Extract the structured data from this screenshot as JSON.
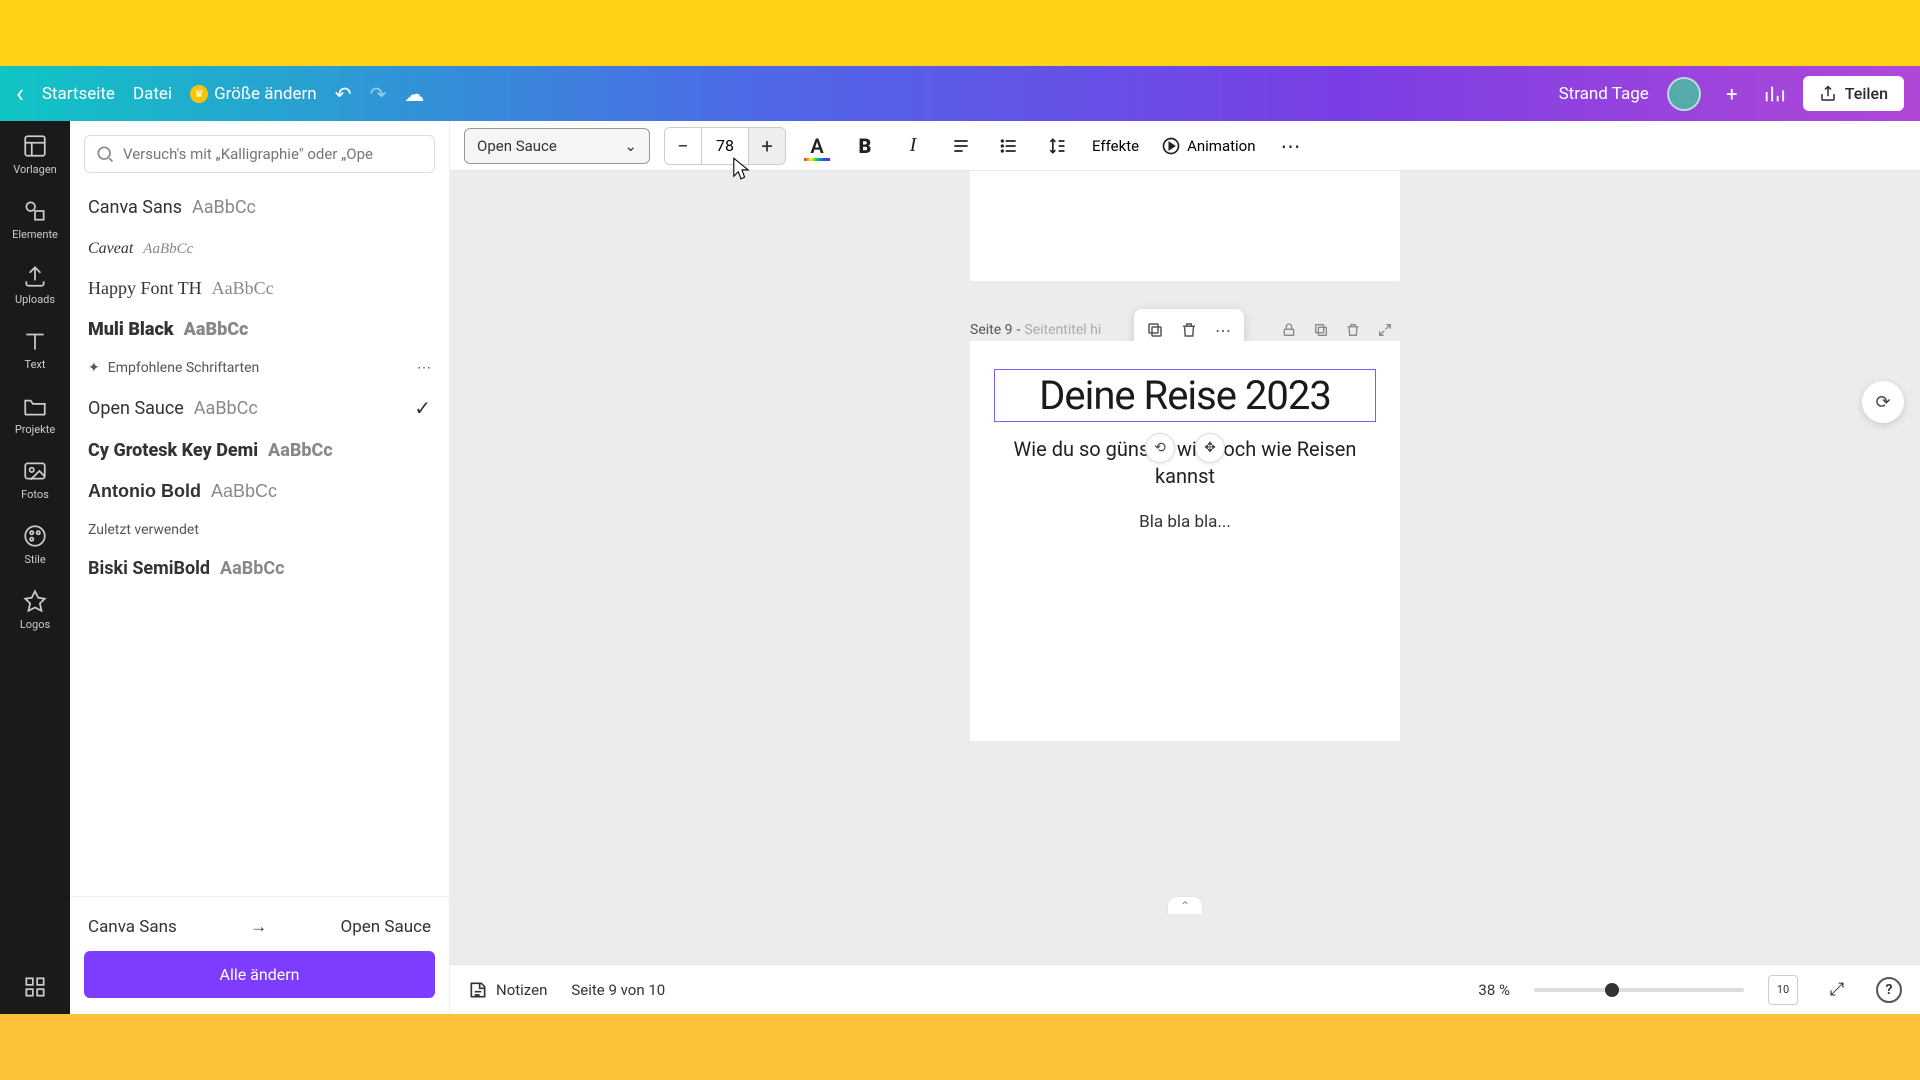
{
  "topbar": {
    "home": "Startseite",
    "file": "Datei",
    "resize": "Größe ändern",
    "projectName": "Strand Tage",
    "share": "Teilen"
  },
  "rail": {
    "templates": "Vorlagen",
    "elements": "Elemente",
    "uploads": "Uploads",
    "text": "Text",
    "projects": "Projekte",
    "photos": "Fotos",
    "styles": "Stile",
    "logos": "Logos"
  },
  "fontpanel": {
    "searchPlaceholder": "Versuch's mit „Kalligraphie\" oder „Ope",
    "recommendedHeader": "Empfohlene Schriftarten",
    "recentHeader": "Zuletzt verwendet",
    "sample": "AaBbCc",
    "fontsTop": [
      {
        "name": "Canva Sans"
      },
      {
        "name": "Caveat"
      },
      {
        "name": "Happy Font TH"
      },
      {
        "name": "Muli Black"
      }
    ],
    "fontsRec": [
      {
        "name": "Open Sauce",
        "selected": true
      },
      {
        "name": "Cy Grotesk Key Demi"
      },
      {
        "name": "Antonio Bold"
      }
    ],
    "fontsRecent": [
      {
        "name": "Biski SemiBold"
      }
    ],
    "swapFrom": "Canva Sans",
    "swapTo": "Open Sauce",
    "changeAll": "Alle ändern"
  },
  "toolbar": {
    "fontName": "Open Sauce",
    "fontSize": "78",
    "effects": "Effekte",
    "animation": "Animation"
  },
  "pageHeader": {
    "label": "Seite 9",
    "titlePlaceholder": "Seitentitel hi"
  },
  "page": {
    "title": "Deine Reise 2023",
    "subtitle": "Wie du so günstig wie noch wie Reisen kannst",
    "body": "Bla bla bla..."
  },
  "status": {
    "notes": "Notizen",
    "pageInfo": "Seite 9 von 10",
    "zoom": "38 %",
    "gridCount": "10"
  }
}
